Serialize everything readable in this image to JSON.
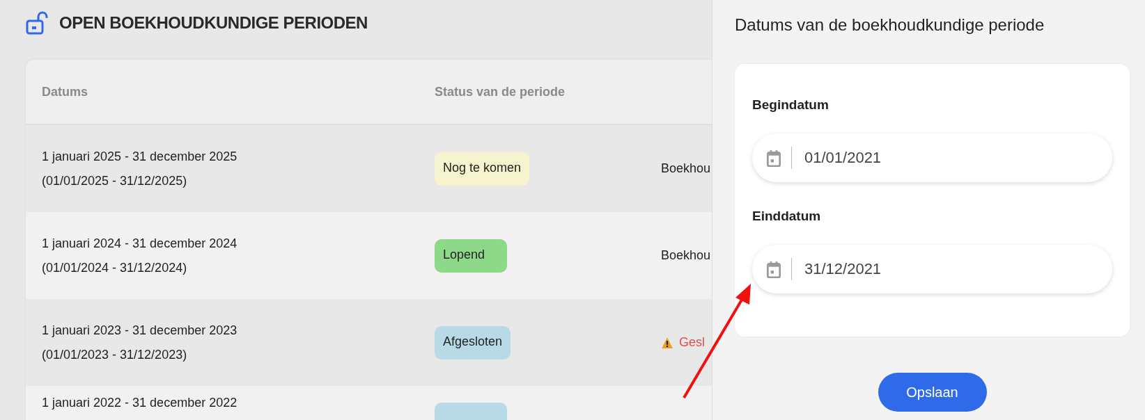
{
  "page": {
    "title": "OPEN BOEKHOUDKUNDIGE PERIODEN"
  },
  "table": {
    "columns": [
      "Datums",
      "Status van de periode"
    ],
    "rows": [
      {
        "dates": "1 januari 2025 - 31 december 2025",
        "dates_numeric": "(01/01/2025 - 31/12/2025)",
        "status": {
          "label": "Nog te komen",
          "kind": "upcoming"
        },
        "column_3": {
          "text": "Boekhou",
          "warning": false
        }
      },
      {
        "dates": "1 januari 2024 - 31 december 2024",
        "dates_numeric": "(01/01/2024 - 31/12/2024)",
        "status": {
          "label": "Lopend",
          "kind": "running"
        },
        "column_3": {
          "text": "Boekhou",
          "warning": false
        }
      },
      {
        "dates": "1 januari 2023 - 31 december 2023",
        "dates_numeric": "(01/01/2023 - 31/12/2023)",
        "status": {
          "label": "Afgesloten",
          "kind": "closed"
        },
        "column_3": {
          "text": "Gesl",
          "warning": true
        }
      },
      {
        "dates": "1 januari 2022 - 31 december 2022",
        "status": {
          "kind": "closed"
        }
      }
    ]
  },
  "panel": {
    "title": "Datums van de boekhoudkundige periode",
    "fields": [
      {
        "label": "Begindatum",
        "value": "01/01/2021"
      },
      {
        "label": "Einddatum",
        "value": "31/12/2021"
      }
    ],
    "save_button": "Opslaan"
  }
}
